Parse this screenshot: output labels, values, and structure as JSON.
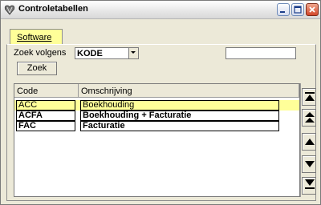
{
  "window": {
    "title": "Controletabellen"
  },
  "tabs": [
    {
      "label": "Software"
    }
  ],
  "search": {
    "label": "Zoek volgens",
    "select_value": "KODE",
    "text_value": "",
    "button_label": "Zoek"
  },
  "grid": {
    "columns": [
      "Code",
      "Omschrijving"
    ],
    "rows": [
      {
        "code": "ACC",
        "omschrijving": "Boekhouding",
        "selected": true
      },
      {
        "code": "ACFA",
        "omschrijving": "Boekhouding + Facturatie",
        "selected": false
      },
      {
        "code": "FAC",
        "omschrijving": "Facturatie",
        "selected": false
      }
    ]
  },
  "colors": {
    "window_bg": "#ECE9D8",
    "selection": "#FFFF99",
    "close_red": "#D2462A"
  },
  "icons": [
    "app-heart-icon",
    "minimize-icon",
    "maximize-icon",
    "close-icon",
    "first-record-icon",
    "page-up-icon",
    "previous-record-icon",
    "next-record-icon",
    "last-record-icon"
  ]
}
